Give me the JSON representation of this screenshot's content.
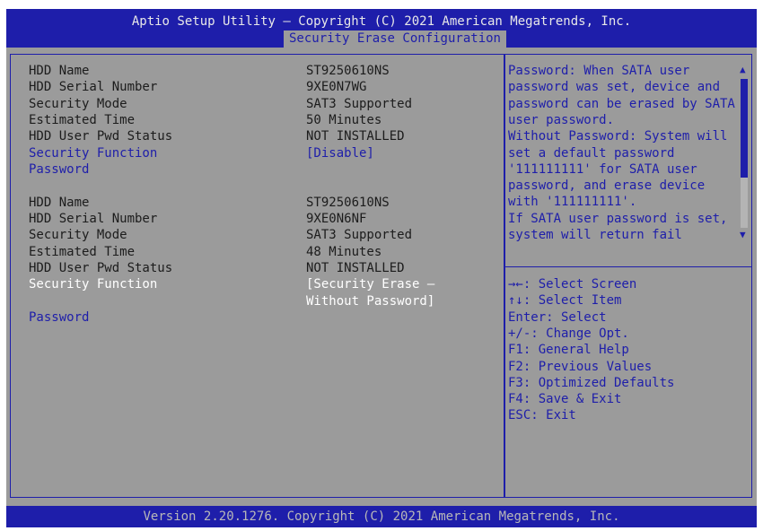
{
  "header": {
    "title": "Aptio Setup Utility – Copyright (C) 2021 American Megatrends, Inc.",
    "active_tab": "Security Erase Configuration"
  },
  "drives": [
    {
      "hdd_name_label": "HDD Name",
      "hdd_name": "ST9250610NS",
      "serial_label": "HDD Serial Number",
      "serial": "9XE0N7WG",
      "mode_label": "Security Mode",
      "mode": "SAT3 Supported",
      "time_label": "Estimated Time",
      "time": "50 Minutes",
      "pwd_status_label": "HDD User Pwd Status",
      "pwd_status": "NOT INSTALLED",
      "function_label": "Security Function",
      "function_value": "[Disable]",
      "password_label": "Password"
    },
    {
      "hdd_name_label": "HDD Name",
      "hdd_name": "ST9250610NS",
      "serial_label": "HDD Serial Number",
      "serial": "9XE0N6NF",
      "mode_label": "Security Mode",
      "mode": "SAT3 Supported",
      "time_label": "Estimated Time",
      "time": "48 Minutes",
      "pwd_status_label": "HDD User Pwd Status",
      "pwd_status": "NOT INSTALLED",
      "function_label": "Security Function",
      "function_value_line1": "[Security Erase –",
      "function_value_line2": "Without Password]",
      "password_label": "Password"
    }
  ],
  "help": {
    "lines": [
      "Password: When SATA user",
      "password was set, device and",
      "password can be erased by SATA",
      "user password.",
      "Without Password: System will",
      "set a default password",
      "'111111111' for SATA user",
      "password, and erase device",
      "with '111111111'.",
      "If SATA user password is set,",
      "system will return fail"
    ],
    "scroll_position": 0.0
  },
  "keys": [
    "→←: Select Screen",
    "↑↓: Select Item",
    "Enter: Select",
    "+/-: Change Opt.",
    "F1: General Help",
    "F2: Previous Values",
    "F3: Optimized Defaults",
    "F4: Save & Exit",
    "ESC: Exit"
  ],
  "footer": "Version 2.20.1276. Copyright (C) 2021 American Megatrends, Inc.",
  "colors": {
    "background": "#9b9b9b",
    "header": "#1e1eaa",
    "accent_text": "#1e1eaa",
    "selected_text": "#ffffff"
  }
}
